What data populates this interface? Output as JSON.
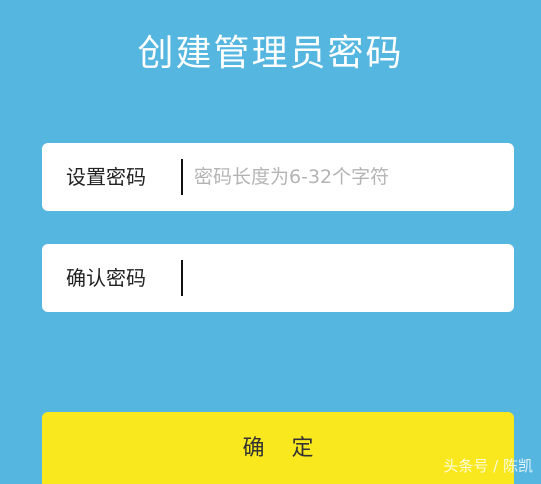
{
  "page": {
    "title": "创建管理员密码"
  },
  "form": {
    "set_password": {
      "label": "设置密码",
      "placeholder": "密码长度为6-32个字符",
      "value": ""
    },
    "confirm_password": {
      "label": "确认密码",
      "placeholder": "",
      "value": ""
    }
  },
  "actions": {
    "confirm_label": "确 定"
  },
  "watermark": "头条号 / 陈凯",
  "colors": {
    "background": "#55b6e0",
    "button": "#fae81e",
    "field": "#ffffff"
  }
}
